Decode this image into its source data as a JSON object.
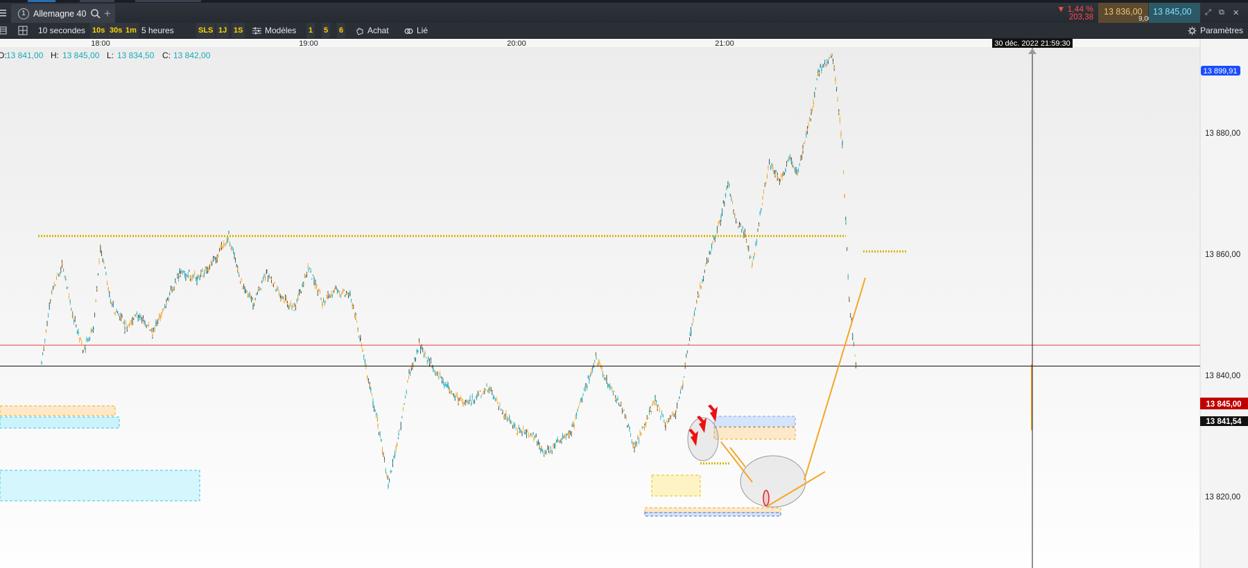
{
  "tab": {
    "number": "1",
    "title": "Allemagne 40",
    "search_icon": "search-icon",
    "add_icon": "plus-icon"
  },
  "quote": {
    "change_pct": "▼ 1,44 %",
    "change_abs": "203,38",
    "bid": "13 836,00",
    "spread": "9,00",
    "ask": "13 845,00"
  },
  "toolbar": {
    "interval": "10 secondes",
    "quick_intervals": [
      "10s",
      "30s",
      "1m"
    ],
    "range": "5 heures",
    "range_presets": [
      "SLS",
      "1J",
      "1S"
    ],
    "models_label": "Modèles",
    "layout_presets": [
      "1",
      "5",
      "6"
    ],
    "buy_label": "Achat",
    "linked_label": "Lié",
    "settings_label": "Paramètres"
  },
  "ohlc": {
    "o_label": "O:",
    "o": "13 841,00",
    "h_label": "H:",
    "h": "13 845,00",
    "l_label": "L:",
    "l": "13 834,50",
    "c_label": "C:",
    "c": "13 842,00"
  },
  "crosshair_label": "30 déc. 2022 21:59:30",
  "price_tags": {
    "alert": "13 899,91",
    "ask_line": "13 845,00",
    "last": "13 841,54"
  },
  "colors": {
    "up": "#1aa9b8",
    "down": "#f0a020",
    "alert": "#1a4dff",
    "ask_tag": "#c00000",
    "level": "#d4b400",
    "drawing": "#f5a623"
  },
  "chart_data": {
    "type": "candlestick",
    "instrument": "Allemagne 40",
    "timeframe": "10 secondes",
    "x_ticks": [
      "18:00",
      "19:00",
      "20:00",
      "21:00"
    ],
    "y_ticks": [
      "13 880,00",
      "13 860,00",
      "13 840,00",
      "13 820,00"
    ],
    "ylim": [
      13818,
      13904
    ],
    "price_path": [
      [
        "17:43",
        13842
      ],
      [
        "17:46",
        13854
      ],
      [
        "17:49",
        13858
      ],
      [
        "17:52",
        13850
      ],
      [
        "17:55",
        13844
      ],
      [
        "17:58",
        13848
      ],
      [
        "18:00",
        13861
      ],
      [
        "18:03",
        13852
      ],
      [
        "18:07",
        13848
      ],
      [
        "18:11",
        13850
      ],
      [
        "18:15",
        13847
      ],
      [
        "18:19",
        13852
      ],
      [
        "18:23",
        13857
      ],
      [
        "18:28",
        13856
      ],
      [
        "18:33",
        13859
      ],
      [
        "18:37",
        13863
      ],
      [
        "18:40",
        13856
      ],
      [
        "18:44",
        13852
      ],
      [
        "18:48",
        13857
      ],
      [
        "18:52",
        13853
      ],
      [
        "18:56",
        13851
      ],
      [
        "19:00",
        13858
      ],
      [
        "19:02",
        13855
      ],
      [
        "19:04",
        13852
      ],
      [
        "19:08",
        13854
      ],
      [
        "19:12",
        13853
      ],
      [
        "19:15",
        13846
      ],
      [
        "19:17",
        13840
      ],
      [
        "19:20",
        13832
      ],
      [
        "19:23",
        13822
      ],
      [
        "19:26",
        13830
      ],
      [
        "19:29",
        13840
      ],
      [
        "19:32",
        13845
      ],
      [
        "19:35",
        13842
      ],
      [
        "19:40",
        13838
      ],
      [
        "19:45",
        13835
      ],
      [
        "19:52",
        13838
      ],
      [
        "19:56",
        13834
      ],
      [
        "20:00",
        13831
      ],
      [
        "20:05",
        13830
      ],
      [
        "20:08",
        13827
      ],
      [
        "20:12",
        13829
      ],
      [
        "20:16",
        13831
      ],
      [
        "20:20",
        13838
      ],
      [
        "20:23",
        13843
      ],
      [
        "20:26",
        13839
      ],
      [
        "20:31",
        13834
      ],
      [
        "20:34",
        13828
      ],
      [
        "20:37",
        13832
      ],
      [
        "20:40",
        13836
      ],
      [
        "20:43",
        13832
      ],
      [
        "20:46",
        13834
      ],
      [
        "20:48",
        13839
      ],
      [
        "20:50",
        13846
      ],
      [
        "20:52",
        13852
      ],
      [
        "20:55",
        13859
      ],
      [
        "20:59",
        13866
      ],
      [
        "21:01",
        13872
      ],
      [
        "21:03",
        13866
      ],
      [
        "21:06",
        13863
      ],
      [
        "21:08",
        13858
      ],
      [
        "21:11",
        13869
      ],
      [
        "21:13",
        13875
      ],
      [
        "21:16",
        13872
      ],
      [
        "21:19",
        13876
      ],
      [
        "21:21",
        13873
      ],
      [
        "21:25",
        13883
      ],
      [
        "21:27",
        13890
      ],
      [
        "21:31",
        13893
      ],
      [
        "21:32",
        13889
      ],
      [
        "21:34",
        13878
      ],
      [
        "21:35",
        13865
      ],
      [
        "21:36",
        13852
      ],
      [
        "21:38",
        13841
      ]
    ],
    "levels": [
      {
        "name": "resistance",
        "price": 13863
      },
      {
        "name": "ask",
        "price": 13845.0
      },
      {
        "name": "last",
        "price": 13841.54
      },
      {
        "name": "alert",
        "price": 13899.91
      }
    ]
  }
}
